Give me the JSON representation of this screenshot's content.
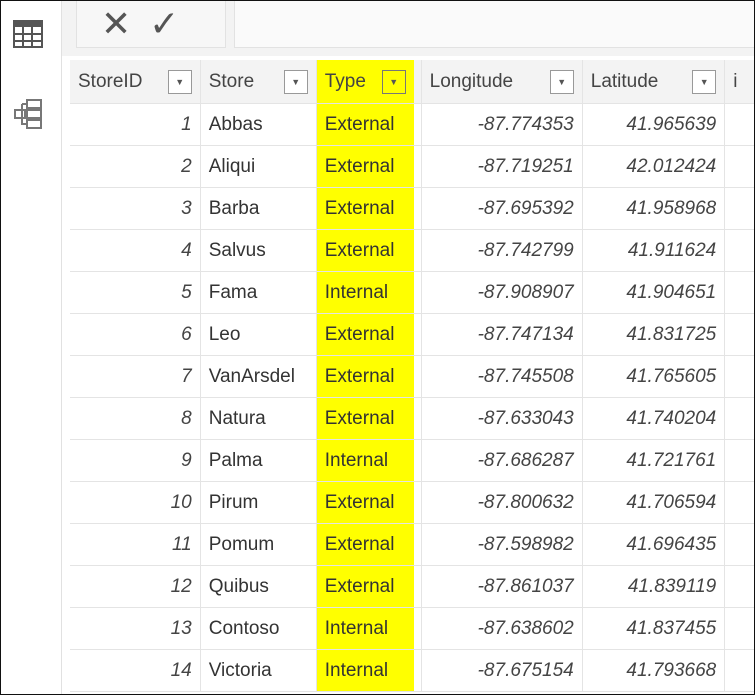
{
  "sidebar": {
    "items": [
      {
        "icon": "table-icon"
      },
      {
        "icon": "model-icon"
      }
    ]
  },
  "toolbar": {
    "cancel": "✕",
    "commit": "✓"
  },
  "table": {
    "columns": [
      "StoreID",
      "Store",
      "Type",
      "Longitude",
      "Latitude",
      "i"
    ],
    "highlight_color": "#ffff00",
    "rows": [
      {
        "id": "1",
        "store": "Abbas",
        "type": "External",
        "lon": "-87.774353",
        "lat": "41.965639"
      },
      {
        "id": "2",
        "store": "Aliqui",
        "type": "External",
        "lon": "-87.719251",
        "lat": "42.012424"
      },
      {
        "id": "3",
        "store": "Barba",
        "type": "External",
        "lon": "-87.695392",
        "lat": "41.958968"
      },
      {
        "id": "4",
        "store": "Salvus",
        "type": "External",
        "lon": "-87.742799",
        "lat": "41.911624"
      },
      {
        "id": "5",
        "store": "Fama",
        "type": "Internal",
        "lon": "-87.908907",
        "lat": "41.904651"
      },
      {
        "id": "6",
        "store": "Leo",
        "type": "External",
        "lon": "-87.747134",
        "lat": "41.831725"
      },
      {
        "id": "7",
        "store": "VanArsdel",
        "type": "External",
        "lon": "-87.745508",
        "lat": "41.765605"
      },
      {
        "id": "8",
        "store": "Natura",
        "type": "External",
        "lon": "-87.633043",
        "lat": "41.740204"
      },
      {
        "id": "9",
        "store": "Palma",
        "type": "Internal",
        "lon": "-87.686287",
        "lat": "41.721761"
      },
      {
        "id": "10",
        "store": "Pirum",
        "type": "External",
        "lon": "-87.800632",
        "lat": "41.706594"
      },
      {
        "id": "11",
        "store": "Pomum",
        "type": "External",
        "lon": "-87.598982",
        "lat": "41.696435"
      },
      {
        "id": "12",
        "store": "Quibus",
        "type": "External",
        "lon": "-87.861037",
        "lat": "41.839119"
      },
      {
        "id": "13",
        "store": "Contoso",
        "type": "Internal",
        "lon": "-87.638602",
        "lat": "41.837455"
      },
      {
        "id": "14",
        "store": "Victoria",
        "type": "Internal",
        "lon": "-87.675154",
        "lat": "41.793668"
      }
    ]
  }
}
